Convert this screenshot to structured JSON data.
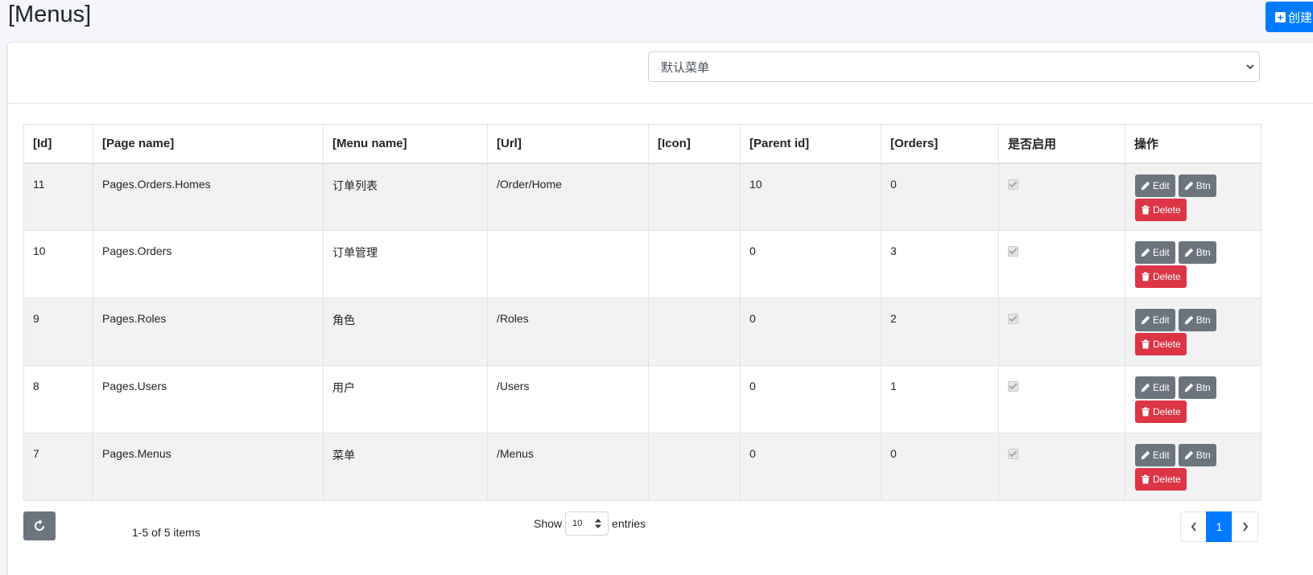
{
  "header": {
    "title": "[Menus]",
    "create_label": "创建"
  },
  "filter": {
    "menu_select_value": "默认菜单"
  },
  "table": {
    "columns": [
      "[Id]",
      "[Page name]",
      "[Menu name]",
      "[Url]",
      "[Icon]",
      "[Parent id]",
      "[Orders]",
      "是否启用",
      "操作"
    ],
    "rows": [
      {
        "id": "11",
        "page_name": "Pages.Orders.Homes",
        "menu_name": "订单列表",
        "url": "/Order/Home",
        "icon": "",
        "parent_id": "10",
        "orders": "0",
        "enabled": true
      },
      {
        "id": "10",
        "page_name": "Pages.Orders",
        "menu_name": "订单管理",
        "url": "",
        "icon": "",
        "parent_id": "0",
        "orders": "3",
        "enabled": true
      },
      {
        "id": "9",
        "page_name": "Pages.Roles",
        "menu_name": "角色",
        "url": "/Roles",
        "icon": "",
        "parent_id": "0",
        "orders": "2",
        "enabled": true
      },
      {
        "id": "8",
        "page_name": "Pages.Users",
        "menu_name": "用户",
        "url": "/Users",
        "icon": "",
        "parent_id": "0",
        "orders": "1",
        "enabled": true
      },
      {
        "id": "7",
        "page_name": "Pages.Menus",
        "menu_name": "菜单",
        "url": "/Menus",
        "icon": "",
        "parent_id": "0",
        "orders": "0",
        "enabled": true
      }
    ],
    "actions": {
      "edit_label": "Edit",
      "btn_label": "Btn",
      "delete_label": "Delete"
    }
  },
  "footer": {
    "items_text": "1-5 of 5 items",
    "show_label": "Show",
    "entries_value": "10",
    "entries_label": "entries",
    "current_page": "1"
  },
  "colors": {
    "primary": "#007bff",
    "secondary": "#6c757d",
    "danger": "#dc3545"
  }
}
